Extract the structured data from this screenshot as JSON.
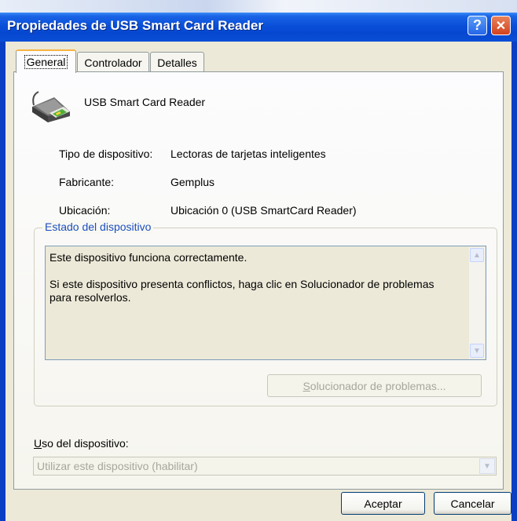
{
  "window": {
    "title": "Propiedades de USB Smart Card Reader",
    "help_glyph": "?",
    "close_glyph": "✕"
  },
  "tabs": [
    {
      "label": "General",
      "active": true
    },
    {
      "label": "Controlador",
      "active": false
    },
    {
      "label": "Detalles",
      "active": false
    }
  ],
  "device": {
    "name": "USB Smart Card Reader",
    "icon": "smart-card-reader-icon"
  },
  "properties": [
    {
      "label": "Tipo de dispositivo:",
      "value": "Lectoras de tarjetas inteligentes"
    },
    {
      "label": "Fabricante:",
      "value": "Gemplus"
    },
    {
      "label": "Ubicación:",
      "value": "Ubicación 0 (USB SmartCard Reader)"
    }
  ],
  "status": {
    "group_label": "Estado del dispositivo",
    "line1": "Este dispositivo funciona correctamente.",
    "line2": "Si este dispositivo presenta conflictos, haga clic en Solucionador de problemas para resolverlos.",
    "troubleshoot_button": {
      "access_key": "S",
      "rest": "olucionador de problemas..."
    }
  },
  "usage": {
    "label_key": "U",
    "label_rest": "so del dispositivo:",
    "value": "Utilizar este dispositivo (habilitar)"
  },
  "buttons": {
    "ok": "Aceptar",
    "cancel": "Cancelar"
  },
  "colors": {
    "titlebar": "#0a4fd8",
    "dialog_bg": "#ece9d8",
    "group_label": "#1b4fc0",
    "tab_highlight": "#f8b33e"
  }
}
